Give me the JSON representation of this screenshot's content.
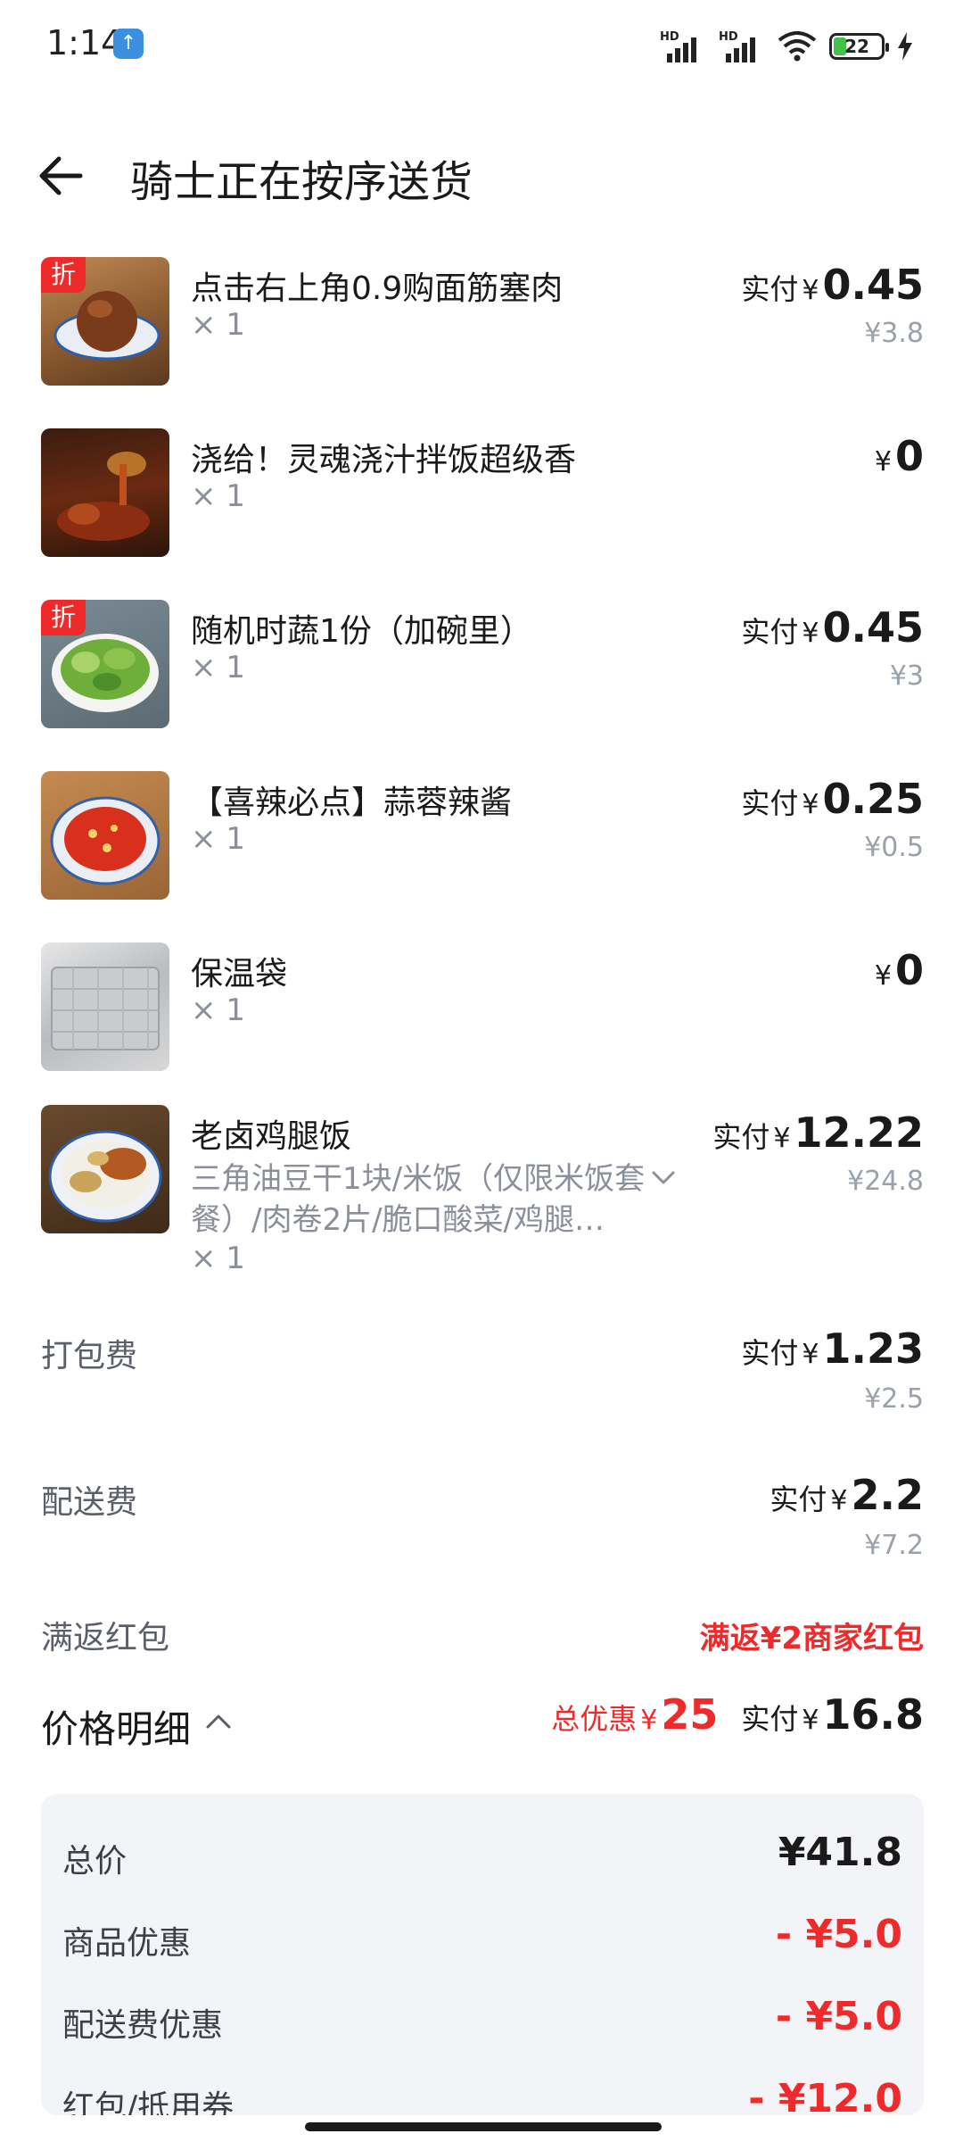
{
  "status": {
    "time": "1:14",
    "battery": "22",
    "hd1": "HD",
    "hd2": "HD"
  },
  "header": {
    "title": "骑士正在按序送货"
  },
  "items": [
    {
      "badge": "折",
      "name": "点击右上角0.9购面筋塞肉",
      "qty": "× 1",
      "prefix": "实付",
      "currency": "¥",
      "amount": "0.45",
      "original": "¥3.8"
    },
    {
      "badge": "",
      "name": "浇给！灵魂浇汁拌饭超级香",
      "qty": "× 1",
      "prefix": "",
      "currency": "¥",
      "amount": "0",
      "original": ""
    },
    {
      "badge": "折",
      "name": "随机时蔬1份（加碗里）",
      "qty": "× 1",
      "prefix": "实付",
      "currency": "¥",
      "amount": "0.45",
      "original": "¥3"
    },
    {
      "badge": "",
      "name": "【喜辣必点】蒜蓉辣酱",
      "qty": "× 1",
      "prefix": "实付",
      "currency": "¥",
      "amount": "0.25",
      "original": "¥0.5"
    },
    {
      "badge": "",
      "name": "保温袋",
      "qty": "× 1",
      "prefix": "",
      "currency": "¥",
      "amount": "0",
      "original": ""
    },
    {
      "badge": "",
      "name": "老卤鸡腿饭",
      "desc": "三角油豆干1块/米饭（仅限米饭套餐）/肉卷2片/脆口酸菜/鸡腿…",
      "qty": "× 1",
      "prefix": "实付",
      "currency": "¥",
      "amount": "12.22",
      "original": "¥24.8"
    }
  ],
  "fees": {
    "packing": {
      "label": "打包费",
      "prefix": "实付",
      "currency": "¥",
      "amount": "1.23",
      "original": "¥2.5"
    },
    "delivery": {
      "label": "配送费",
      "prefix": "实付",
      "currency": "¥",
      "amount": "2.2",
      "original": "¥7.2"
    },
    "redpacket": {
      "label": "满返红包",
      "value": "满返¥2商家红包"
    }
  },
  "breakdown": {
    "title": "价格明细",
    "discount_label": "总优惠",
    "discount_currency": "¥",
    "discount_amount": "25",
    "paid_label": "实付",
    "paid_currency": "¥",
    "paid_amount": "16.8",
    "rows": [
      {
        "label": "总价",
        "value": "¥41.8"
      },
      {
        "label": "商品优惠",
        "value": "- ¥5.0"
      },
      {
        "label": "配送费优惠",
        "value": "- ¥5.0"
      },
      {
        "label": "红包/抵用券",
        "value": "- ¥12.0"
      }
    ]
  }
}
